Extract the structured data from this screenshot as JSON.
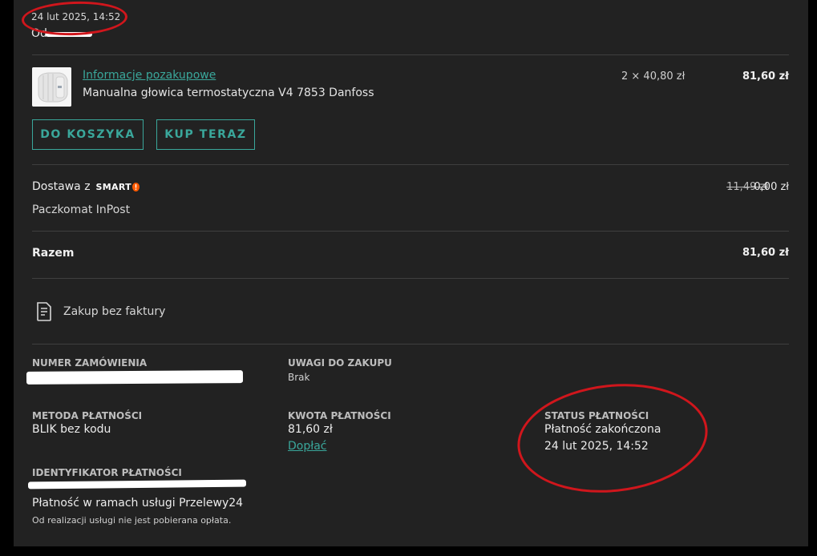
{
  "header": {
    "date": "24 lut 2025, 14:52",
    "seller_prefix": "Od"
  },
  "product": {
    "thumb_icon": "thermostat-head-icon",
    "link": "Informacje pozakupowe",
    "name": "Manualna głowica termostatyczna V4 7853 Danfoss",
    "quantity": "2 × 40,80 zł",
    "price": "81,60 zł"
  },
  "buttons": {
    "cart": "DO KOSZYKA",
    "buy_now": "KUP TERAZ"
  },
  "delivery": {
    "label": "Dostawa z",
    "brand": "SMART",
    "old_price": "11,49 zł",
    "price": "0,00 zł",
    "method": "Paczkomat InPost"
  },
  "total": {
    "label": "Razem",
    "value": "81,60 zł"
  },
  "invoice": {
    "icon": "document-icon",
    "label": "Zakup bez faktury"
  },
  "details": {
    "order_number_label": "NUMER ZAMÓWIENIA",
    "notes_label": "UWAGI DO ZAKUPU",
    "notes_value": "Brak",
    "payment_method_label": "METODA PŁATNOŚCI",
    "payment_method_value": "BLIK bez kodu",
    "payment_amount_label": "KWOTA PŁATNOŚCI",
    "payment_amount_value": "81,60 zł",
    "top_up_link": "Dopłać",
    "payment_status_label": "STATUS PŁATNOŚCI",
    "payment_status_value": "Płatność zakończona",
    "payment_status_date": "24 lut 2025, 14:52",
    "payment_id_label": "IDENTYFIKATOR PŁATNOŚCI",
    "payment_service": "Płatność w ramach usługi Przelewy24",
    "payment_fee_note": "Od realizacji usługi nie jest pobierana opłata."
  },
  "colors": {
    "accent": "#3aa79b",
    "background": "#222222",
    "annotation": "#d0161c",
    "smart_brand": "#ff5a00"
  }
}
